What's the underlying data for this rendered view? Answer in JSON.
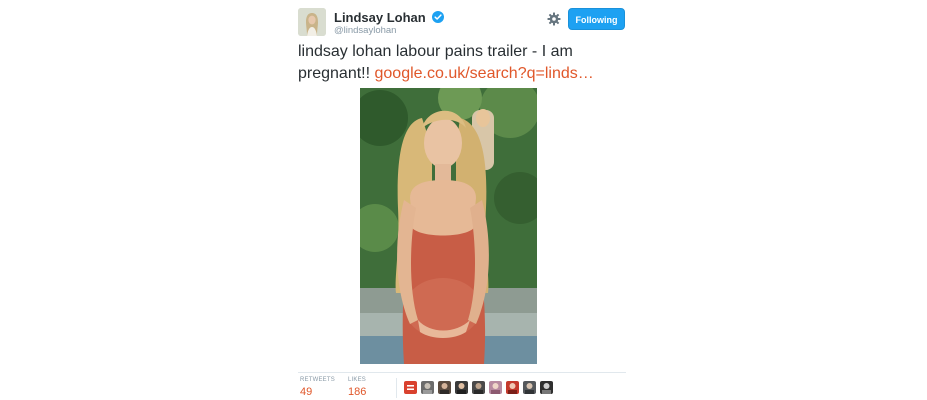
{
  "tweet": {
    "display_name": "Lindsay Lohan",
    "handle": "@lindsaylohan",
    "follow_button_label": "Following",
    "text": "lindsay lohan labour pains trailer - I am pregnant!! ",
    "link_text": "google.co.uk/search?q=linds…",
    "stats": {
      "retweets_label": "RETWEETS",
      "retweets_value": "49",
      "likes_label": "LIKES",
      "likes_value": "186"
    },
    "liker_avatar_count": 9
  },
  "colors": {
    "link": "#e0572a",
    "follow_button": "#1da1f2",
    "verified": "#1da1f2",
    "muted": "#8899a6"
  },
  "icons": [
    "verified-badge-icon",
    "gear-icon"
  ]
}
